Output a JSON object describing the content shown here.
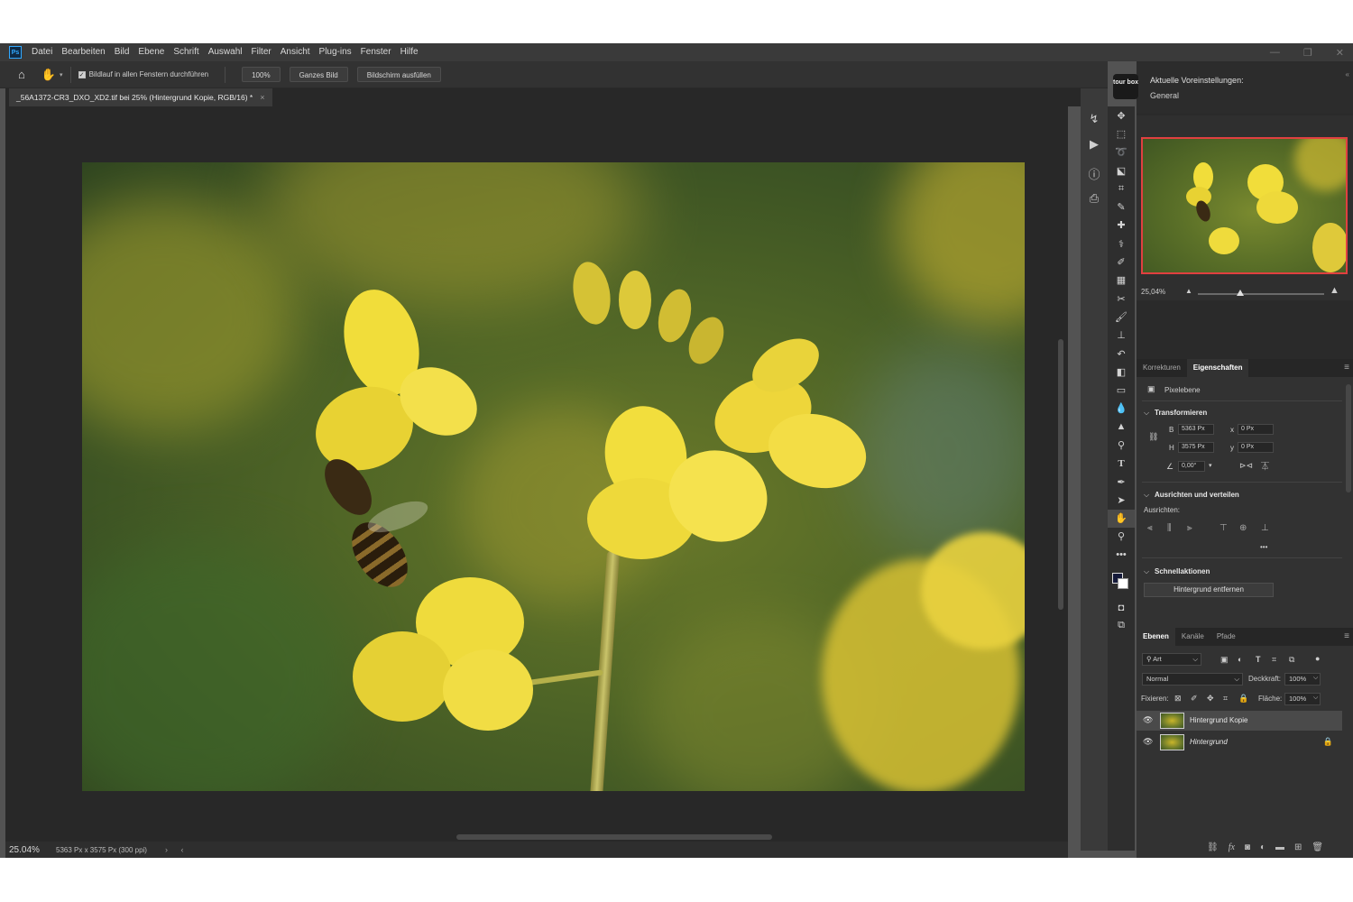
{
  "app": {
    "logo": "Ps",
    "menu": [
      "Datei",
      "Bearbeiten",
      "Bild",
      "Ebene",
      "Schrift",
      "Auswahl",
      "Filter",
      "Ansicht",
      "Plug-ins",
      "Fenster",
      "Hilfe"
    ],
    "window_controls": {
      "minimize": "—",
      "restore": "❐",
      "close": "✕"
    }
  },
  "options_bar": {
    "home_icon": "home-icon",
    "hand_icon": "hand-icon",
    "scroll_all_label": "Bildlauf in allen Fenstern durchführen",
    "scroll_all_checked": true,
    "zoom_100_label": "100%",
    "fit_screen_label": "Ganzes Bild",
    "fill_screen_label": "Bildschirm ausfüllen"
  },
  "document": {
    "tab_title": "_56A1372-CR3_DXO_XD2.tif bei 25% (Hintergrund Kopie, RGB/16) *",
    "close_glyph": "×"
  },
  "status": {
    "zoom": "25.04%",
    "info": "5363 Px x 3575 Px (300 ppi)",
    "arrows": "› ‹"
  },
  "tourbox": {
    "logo_text": "tour box",
    "title": "Aktuelle Voreinstellungen:",
    "preset": "General"
  },
  "navigator": {
    "zoom": "25,04%",
    "zoom_fraction": 0.25
  },
  "properties": {
    "tabs": [
      {
        "label": "Korrekturen",
        "active": false
      },
      {
        "label": "Eigenschaften",
        "active": true
      }
    ],
    "layer_type": "Pixelebene",
    "transform_title": "Transformieren",
    "w_label": "B",
    "w_value": "5363 Px",
    "h_label": "H",
    "h_value": "3575 Px",
    "x_label": "x",
    "x_value": "0 Px",
    "y_label": "y",
    "y_value": "0 Px",
    "angle_value": "0,00°",
    "align_title": "Ausrichten und verteilen",
    "align_sub": "Ausrichten:",
    "more_glyph": "•••",
    "quick_title": "Schnellaktionen",
    "remove_bg_label": "Hintergrund entfernen"
  },
  "layers": {
    "tabs": [
      {
        "label": "Ebenen",
        "active": true
      },
      {
        "label": "Kanäle",
        "active": false
      },
      {
        "label": "Pfade",
        "active": false
      }
    ],
    "filter_label": "Art",
    "blend_mode": "Normal",
    "opacity_label": "Deckkraft:",
    "opacity_value": "100%",
    "lock_label": "Fixieren:",
    "fill_label": "Fläche:",
    "fill_value": "100%",
    "items": [
      {
        "name": "Hintergrund Kopie",
        "selected": true,
        "locked": false,
        "italic": false
      },
      {
        "name": "Hintergrund",
        "selected": false,
        "locked": true,
        "italic": true
      }
    ]
  },
  "colors": {
    "foreground": "#151a3a",
    "background": "#ffffff",
    "navigator_frame": "#e04040"
  }
}
